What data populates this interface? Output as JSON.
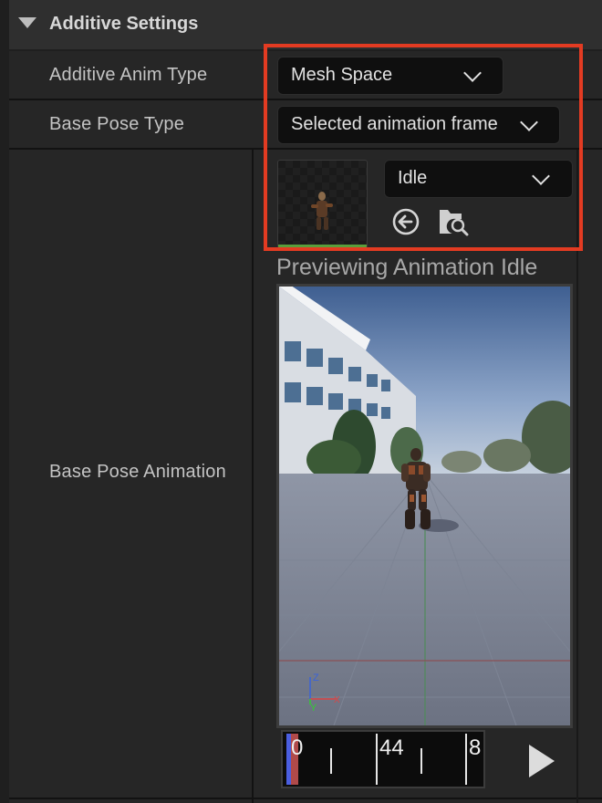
{
  "section": {
    "title": "Additive Settings"
  },
  "rows": {
    "additive_anim_type": {
      "label": "Additive Anim Type",
      "value": "Mesh Space"
    },
    "base_pose_type": {
      "label": "Base Pose Type",
      "value": "Selected animation frame"
    },
    "base_pose_animation": {
      "label": "Base Pose Animation",
      "asset_value": "Idle",
      "preview_caption": "Previewing Animation Idle"
    }
  },
  "timeline": {
    "start": "0",
    "middle": "44",
    "end": "8",
    "playhead_frame": 0
  },
  "axis_gizmo": {
    "z": "Z",
    "y": "Y",
    "x": "X"
  },
  "icons": {
    "collapse": "triangle-down-icon",
    "dropdown": "chevron-down-icon",
    "use_selected": "arrow-left-circle-icon",
    "browse": "folder-search-icon",
    "play": "play-icon"
  },
  "colors": {
    "highlight": "#e33b22",
    "thumbnail_bar": "#5a9e3b",
    "playhead": "#b04a4a"
  }
}
